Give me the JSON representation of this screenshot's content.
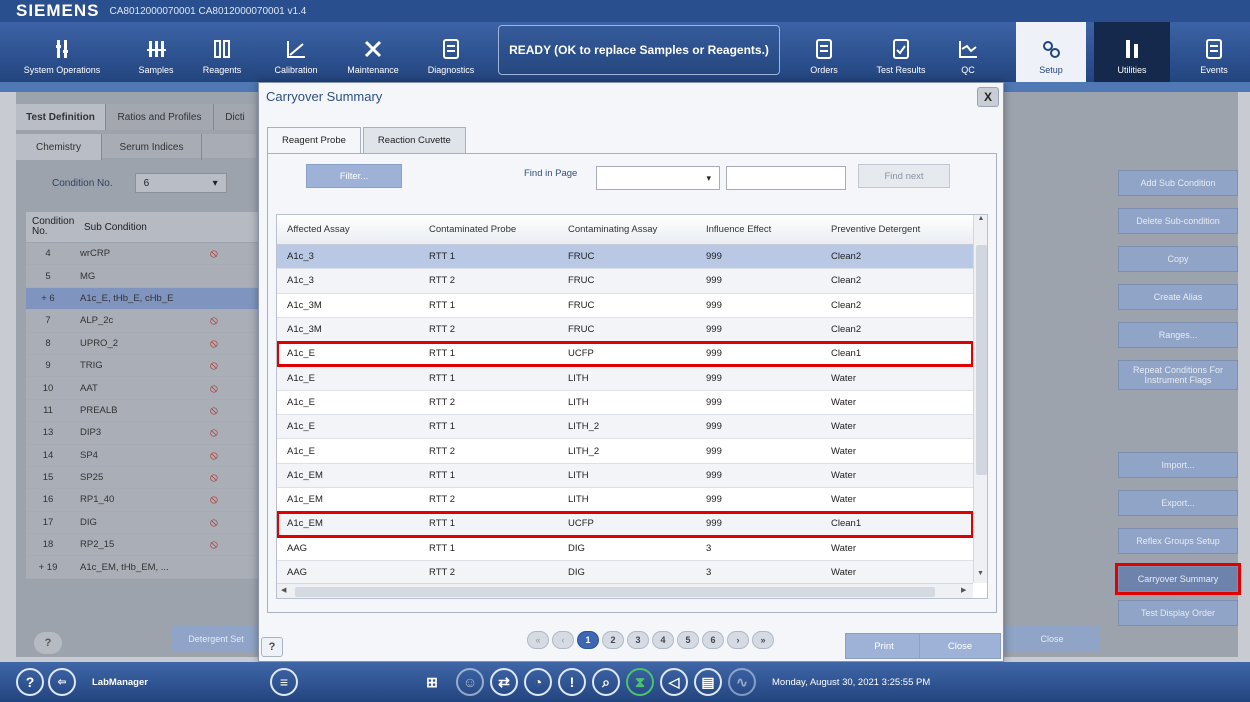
{
  "header": {
    "brand": "SIEMENS",
    "app_id": "CA8012000070001 CA8012000070001 v1.4"
  },
  "toolbar": {
    "items": [
      {
        "label": "System Operations",
        "icon": "system-operations-icon"
      },
      {
        "label": "Samples",
        "icon": "samples-icon"
      },
      {
        "label": "Reagents",
        "icon": "reagents-icon"
      },
      {
        "label": "Calibration",
        "icon": "calibration-icon"
      },
      {
        "label": "Maintenance",
        "icon": "maintenance-icon"
      },
      {
        "label": "Diagnostics",
        "icon": "diagnostics-icon"
      },
      {
        "label": "Orders",
        "icon": "orders-icon"
      },
      {
        "label": "Test Results",
        "icon": "test-results-icon"
      },
      {
        "label": "QC",
        "icon": "qc-icon"
      },
      {
        "label": "Setup",
        "icon": "setup-icon"
      },
      {
        "label": "Utilities",
        "icon": "utilities-icon"
      },
      {
        "label": "Events",
        "icon": "events-icon"
      }
    ],
    "status": "READY (OK to replace Samples or Reagents.)"
  },
  "background": {
    "tabs": [
      "Test Definition",
      "Ratios and Profiles",
      "Dicti"
    ],
    "subtabs": [
      "Chemistry",
      "Serum Indices"
    ],
    "condition_label": "Condition No.",
    "condition_value": "6",
    "grid_headers": [
      "Condition No.",
      "Sub Condition"
    ],
    "rows": [
      {
        "no": "4",
        "sub": "wrCRP",
        "flag": "⦸"
      },
      {
        "no": "5",
        "sub": "MG",
        "flag": ""
      },
      {
        "no": "+ 6",
        "sub": "A1c_E, tHb_E, cHb_E",
        "flag": ""
      },
      {
        "no": "7",
        "sub": "ALP_2c",
        "flag": "⦸"
      },
      {
        "no": "8",
        "sub": "UPRO_2",
        "flag": "⦸"
      },
      {
        "no": "9",
        "sub": "TRIG",
        "flag": "⦸"
      },
      {
        "no": "10",
        "sub": "AAT",
        "flag": "⦸"
      },
      {
        "no": "11",
        "sub": "PREALB",
        "flag": "⦸"
      },
      {
        "no": "13",
        "sub": "DIP3",
        "flag": "⦸"
      },
      {
        "no": "14",
        "sub": "SP4",
        "flag": "⦸"
      },
      {
        "no": "15",
        "sub": "SP25",
        "flag": "⦸"
      },
      {
        "no": "16",
        "sub": "RP1_40",
        "flag": "⦸"
      },
      {
        "no": "17",
        "sub": "DIG",
        "flag": "⦸"
      },
      {
        "no": "18",
        "sub": "RP2_15",
        "flag": "⦸"
      },
      {
        "no": "+ 19",
        "sub": "A1c_EM, tHb_EM, ...",
        "flag": ""
      }
    ],
    "right_buttons": [
      "Add Sub Condition",
      "Delete Sub-condition",
      "Copy",
      "Create Alias",
      "Ranges...",
      "Repeat Conditions For Instrument Flags",
      "Import...",
      "Export...",
      "Reflex Groups Setup",
      "Carryover Summary",
      "Test Display Order"
    ],
    "help": "?",
    "detergent_set": "Detergent Set",
    "close": "Close"
  },
  "dialog": {
    "title": "Carryover Summary",
    "close_x": "X",
    "tabs": [
      "Reagent Probe",
      "Reaction Cuvette"
    ],
    "filter": "Filter...",
    "find_label": "Find in Page",
    "find_next": "Find next",
    "columns": [
      "Affected Assay",
      "Contaminated Probe",
      "Contaminating Assay",
      "Influence Effect",
      "Preventive Detergent"
    ],
    "rows": [
      [
        "A1c_3",
        "RTT 1",
        "FRUC",
        "999",
        "Clean2"
      ],
      [
        "A1c_3",
        "RTT 2",
        "FRUC",
        "999",
        "Clean2"
      ],
      [
        "A1c_3M",
        "RTT 1",
        "FRUC",
        "999",
        "Clean2"
      ],
      [
        "A1c_3M",
        "RTT 2",
        "FRUC",
        "999",
        "Clean2"
      ],
      [
        "A1c_E",
        "RTT 1",
        "UCFP",
        "999",
        "Clean1"
      ],
      [
        "A1c_E",
        "RTT 1",
        "LITH",
        "999",
        "Water"
      ],
      [
        "A1c_E",
        "RTT 2",
        "LITH",
        "999",
        "Water"
      ],
      [
        "A1c_E",
        "RTT 1",
        "LITH_2",
        "999",
        "Water"
      ],
      [
        "A1c_E",
        "RTT 2",
        "LITH_2",
        "999",
        "Water"
      ],
      [
        "A1c_EM",
        "RTT 1",
        "LITH",
        "999",
        "Water"
      ],
      [
        "A1c_EM",
        "RTT 2",
        "LITH",
        "999",
        "Water"
      ],
      [
        "A1c_EM",
        "RTT 1",
        "UCFP",
        "999",
        "Clean1"
      ],
      [
        "AAG",
        "RTT 1",
        "DIG",
        "3",
        "Water"
      ],
      [
        "AAG",
        "RTT 2",
        "DIG",
        "3",
        "Water"
      ]
    ],
    "pages": [
      "1",
      "2",
      "3",
      "4",
      "5",
      "6"
    ],
    "print": "Print",
    "close": "Close",
    "help": "?"
  },
  "status_bar": {
    "user": "LabManager",
    "datetime": "Monday, August 30, 2021 3:25:55 PM"
  }
}
